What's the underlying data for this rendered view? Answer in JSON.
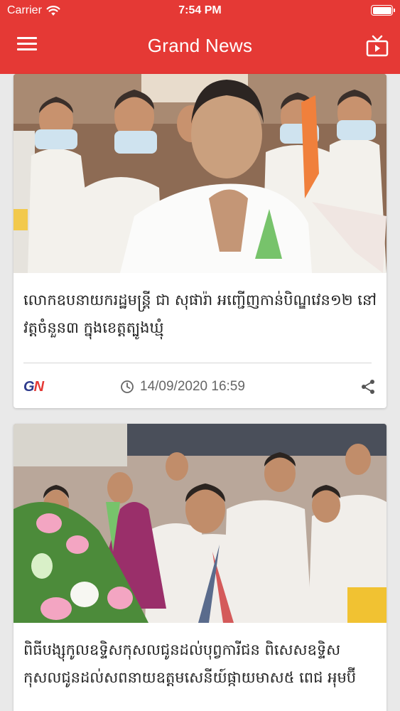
{
  "status_bar": {
    "carrier": "Carrier",
    "time": "7:54 PM"
  },
  "header": {
    "title": "Grand News",
    "menu_icon": "hamburger-menu-icon",
    "live_tv_icon": "tv-icon",
    "background_color": "#e53935"
  },
  "articles": [
    {
      "headline": "លោកឧបនាយករដ្ឋមន្ត្រី ជា សុផារ៉ា អញ្ជើញកាន់បិណ្ឌវេន១២ នៅវត្តចំនួន៣ ក្នុងខេត្តត្បូងឃ្មុំ",
      "logo_text_left": "G",
      "logo_text_right": "N",
      "date": "14/09/2020 16:59",
      "clock_icon": "clock-icon",
      "share_icon": "share-icon"
    },
    {
      "headline": "ពិធីបង្សុកូលឧទ្ទិសកុសលជូនដល់បុព្វការីជន ពិសេសឧទ្ទិសកុសលជូនដល់សពនាយឧត្តមសេនីយ៍ផ្កាយមាស៥ ពេជ អុមប៊ី"
    }
  ]
}
